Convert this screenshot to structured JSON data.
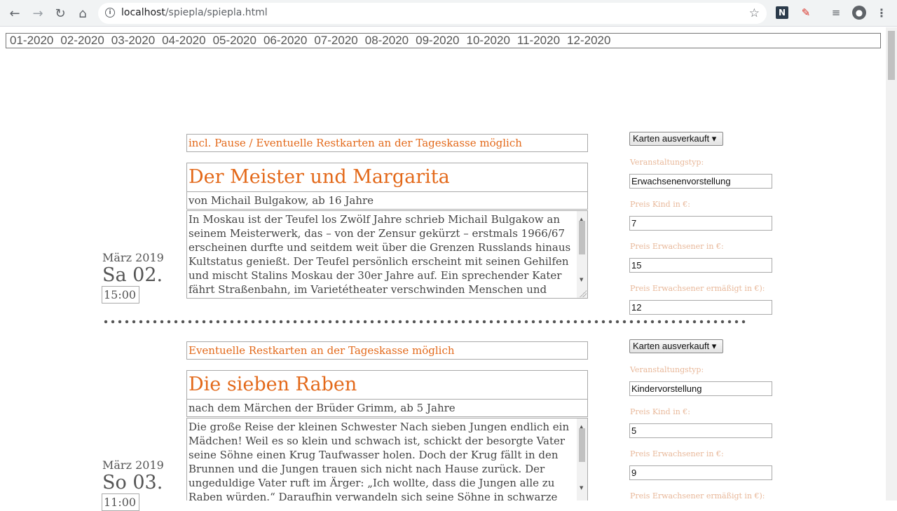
{
  "browser": {
    "url_host": "localhost",
    "url_path": "/spiepla/spiepla.html"
  },
  "months": [
    "01-2020",
    "02-2020",
    "03-2020",
    "04-2020",
    "05-2020",
    "06-2020",
    "07-2020",
    "08-2020",
    "09-2020",
    "10-2020",
    "11-2020",
    "12-2020"
  ],
  "events": [
    {
      "notice": "incl. Pause / Eventuelle Restkarten an der Tageskasse möglich",
      "title": "Der Meister und Margarita",
      "subtitle": "von Michail Bulgakow, ab 16 Jahre",
      "description": "In Moskau ist der Teufel los Zwölf Jahre schrieb Michail Bulgakow an seinem Meisterwerk, das – von der Zensur gekürzt – erstmals 1966/67 erscheinen durfte und seitdem weit über die Grenzen Russlands hinaus Kultstatus genießt. Der Teufel persönlich erscheint mit seinen Gehilfen und mischt Stalins Moskau der 30er Jahre auf. Ein sprechender Kater fährt Straßenbahn, im Varietétheater verschwinden Menschen und Geldscheine, im dekadenten Literatenclub fehlt der",
      "month": "März 2019",
      "day": "Sa 02.",
      "time": "15:00",
      "ticket_status": "Karten ausverkauft",
      "type_label": "Veranstaltungstyp:",
      "type_value": "Erwachsenenvorstellung",
      "price_child_label": "Preis Kind in €:",
      "price_child": "7",
      "price_adult_label": "Preis Erwachsener in €:",
      "price_adult": "15",
      "price_reduced_label": "Preis Erwachsener ermäßigt in €):",
      "price_reduced": "12"
    },
    {
      "notice": "Eventuelle Restkarten an der Tageskasse möglich",
      "title": "Die sieben Raben",
      "subtitle": "nach dem Märchen der Brüder Grimm, ab 5 Jahre",
      "description": "Die große Reise der kleinen Schwester Nach sieben Jungen endlich ein Mädchen! Weil es so klein und schwach ist, schickt der besorgte Vater seine Söhne einen Krug Taufwasser holen. Doch der Krug fällt in den Brunnen und die Jungen trauen sich nicht nach Hause zurück. Der ungeduldige Vater ruft im Ärger: „Ich wollte, dass die Jungen alle zu Raben würden.“ Daraufhin verwandeln sich seine Söhne in schwarze Vögel und fliegen davon. Als die",
      "month": "März 2019",
      "day": "So 03.",
      "time": "11:00",
      "ticket_status": "Karten ausverkauft",
      "type_label": "Veranstaltungstyp:",
      "type_value": "Kindervorstellung",
      "price_child_label": "Preis Kind in €:",
      "price_child": "5",
      "price_adult_label": "Preis Erwachsener in €:",
      "price_adult": "9",
      "price_reduced_label": "Preis Erwachsener ermäßigt in €):",
      "price_reduced": ""
    }
  ]
}
